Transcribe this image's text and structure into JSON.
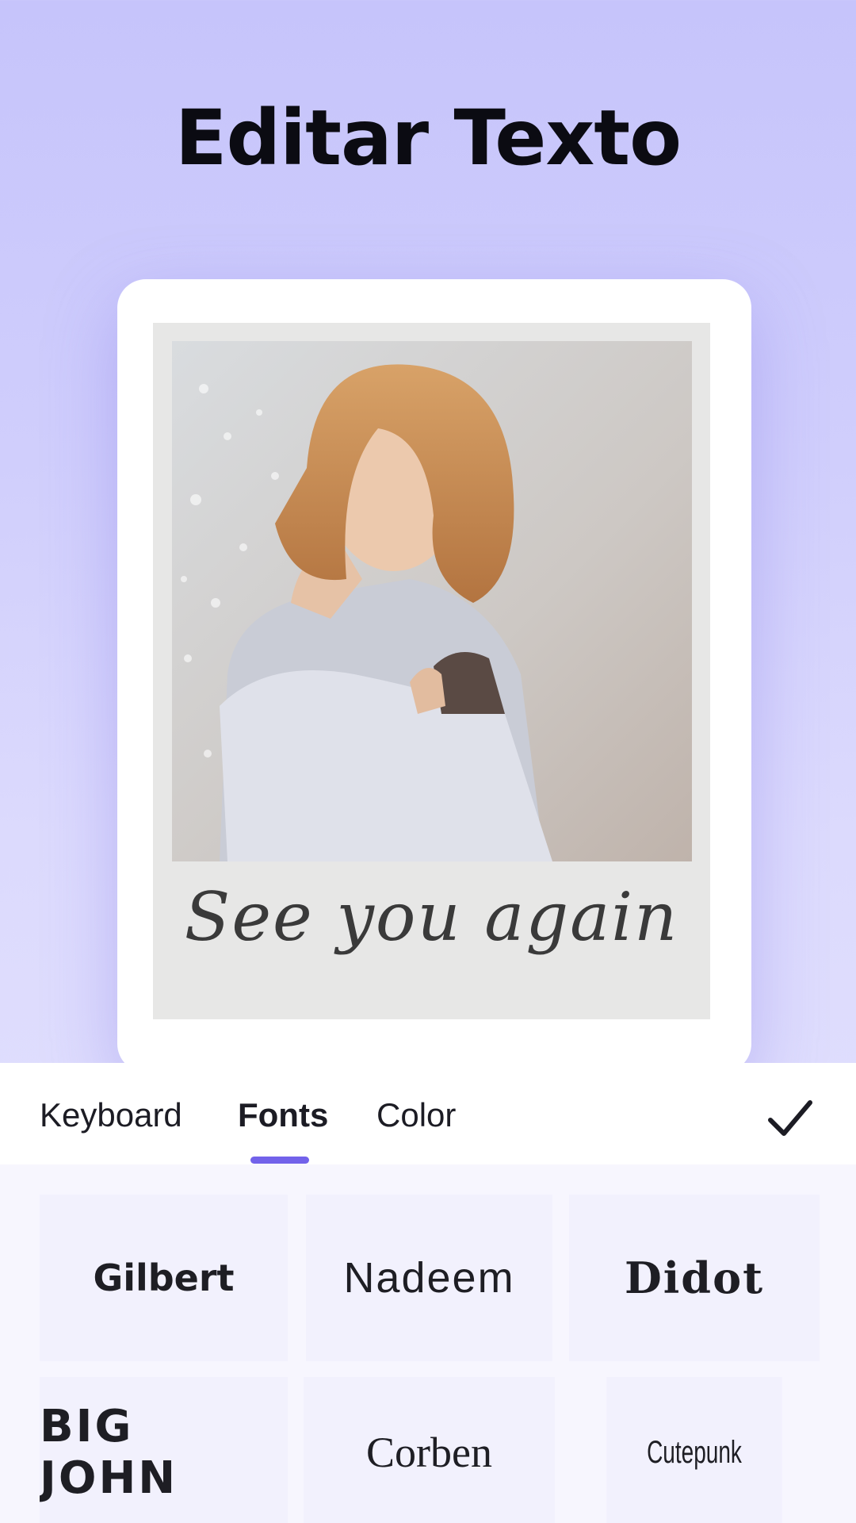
{
  "header": {
    "title": "Editar Texto"
  },
  "preview": {
    "caption": "See you again"
  },
  "tabs": [
    {
      "label": "Keyboard"
    },
    {
      "label": "Fonts"
    },
    {
      "label": "Color"
    }
  ],
  "active_tab": "Fonts",
  "accent_color": "#7262ea",
  "done_icon": "check-icon",
  "fonts": [
    {
      "label": "Gilbert"
    },
    {
      "label": "Nadeem"
    },
    {
      "label": "Didot"
    },
    {
      "label": "BIG JOHN"
    },
    {
      "label": "Corben"
    },
    {
      "label": "Cutepunk"
    }
  ]
}
